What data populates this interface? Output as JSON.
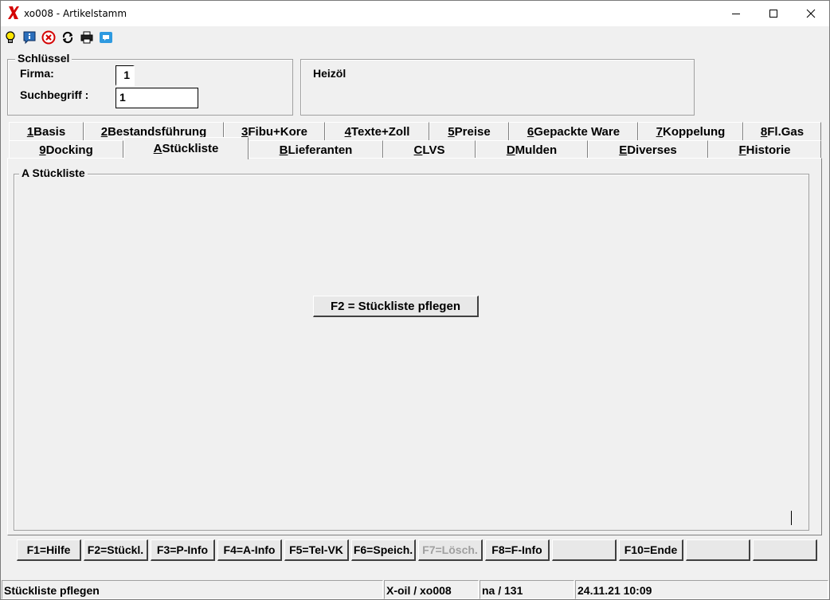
{
  "window": {
    "title": "xo008 - Artikelstamm",
    "minimize_label": "—",
    "maximize_label": "☐",
    "close_label": "✕"
  },
  "toolbar": {
    "icons": [
      "lightbulb-icon",
      "info-icon",
      "cancel-icon",
      "refresh-icon",
      "print-icon",
      "chat-icon"
    ]
  },
  "key_group": {
    "legend": "Schlüssel",
    "firma_label": "Firma:",
    "firma_value": "1",
    "suchbegriff_label": "Suchbegriff :",
    "suchbegriff_value": "1"
  },
  "info_group": {
    "text": "Heizöl"
  },
  "tabs_row1": [
    {
      "key": "1",
      "label": " Basis"
    },
    {
      "key": "2",
      "label": " Bestandsführung"
    },
    {
      "key": "3",
      "label": " Fibu+Kore"
    },
    {
      "key": "4",
      "label": " Texte+Zoll"
    },
    {
      "key": "5",
      "label": " Preise"
    },
    {
      "key": "6",
      "label": " Gepackte Ware"
    },
    {
      "key": "7",
      "label": " Koppelung"
    },
    {
      "key": "8",
      "label": " Fl.Gas"
    }
  ],
  "tabs_row2": [
    {
      "key": "9",
      "label": " Docking"
    },
    {
      "key": "A",
      "label": " Stückliste"
    },
    {
      "key": "B",
      "label": " Lieferanten"
    },
    {
      "key": "C",
      "label": " LVS"
    },
    {
      "key": "D",
      "label": " Mulden"
    },
    {
      "key": "E",
      "label": " Diverses"
    },
    {
      "key": "F",
      "label": " Historie"
    }
  ],
  "active_tab": "A Stückliste",
  "panel": {
    "legend": "A Stückliste",
    "action_button": "F2 = Stückliste pflegen"
  },
  "function_keys": [
    {
      "label": "F1=Hilfe",
      "enabled": true
    },
    {
      "label": "F2=Stückl.",
      "enabled": true
    },
    {
      "label": "F3=P-Info",
      "enabled": true
    },
    {
      "label": "F4=A-Info",
      "enabled": true
    },
    {
      "label": "F5=Tel-VK",
      "enabled": true
    },
    {
      "label": "F6=Speich.",
      "enabled": true
    },
    {
      "label": "F7=Lösch.",
      "enabled": false
    },
    {
      "label": "F8=F-Info",
      "enabled": true
    },
    {
      "label": "",
      "enabled": true
    },
    {
      "label": "F10=Ende",
      "enabled": true
    },
    {
      "label": "",
      "enabled": true
    },
    {
      "label": "",
      "enabled": true
    }
  ],
  "status": {
    "message": "Stückliste pflegen",
    "program": "X-oil / xo008",
    "user": "na / 131",
    "datetime": "24.11.21 10:09"
  },
  "colors": {
    "logo_red": "#d40000",
    "window_bg": "#f0f0f0",
    "disabled_text": "#a0a0a0"
  }
}
